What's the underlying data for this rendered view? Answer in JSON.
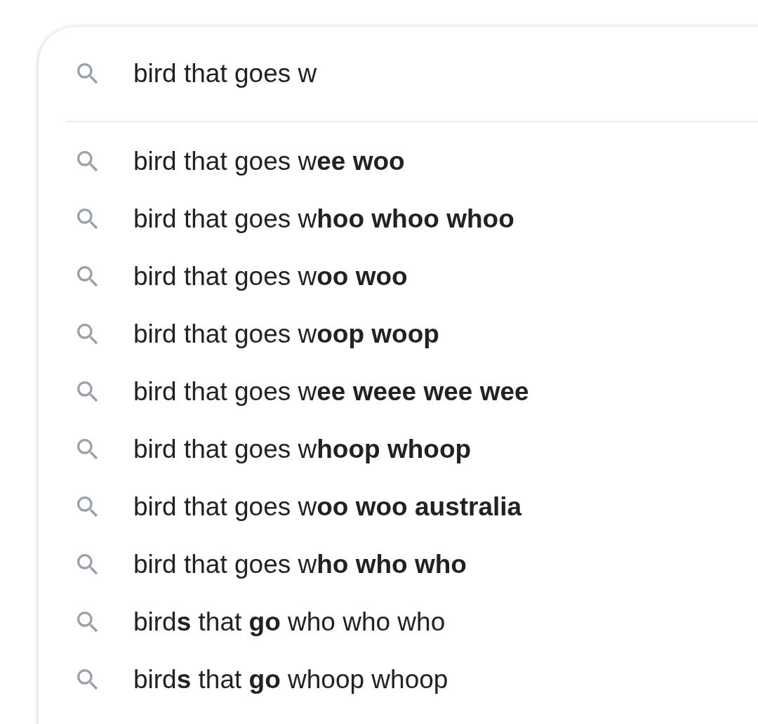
{
  "search": {
    "value": "bird that goes w"
  },
  "suggestions": [
    {
      "text": "bird that goes w**ee woo**"
    },
    {
      "text": "bird that goes w**hoo whoo whoo**"
    },
    {
      "text": "bird that goes w**oo woo**"
    },
    {
      "text": "bird that goes w**oop woop**"
    },
    {
      "text": "bird that goes w**ee weee wee wee**"
    },
    {
      "text": "bird that goes w**hoop whoop**"
    },
    {
      "text": "bird that goes w**oo woo australia**"
    },
    {
      "text": "bird that goes w**ho who who**"
    },
    {
      "text": "bird**s** that **go** who who who"
    },
    {
      "text": "bird**s** that **go** whoop whoop"
    }
  ]
}
